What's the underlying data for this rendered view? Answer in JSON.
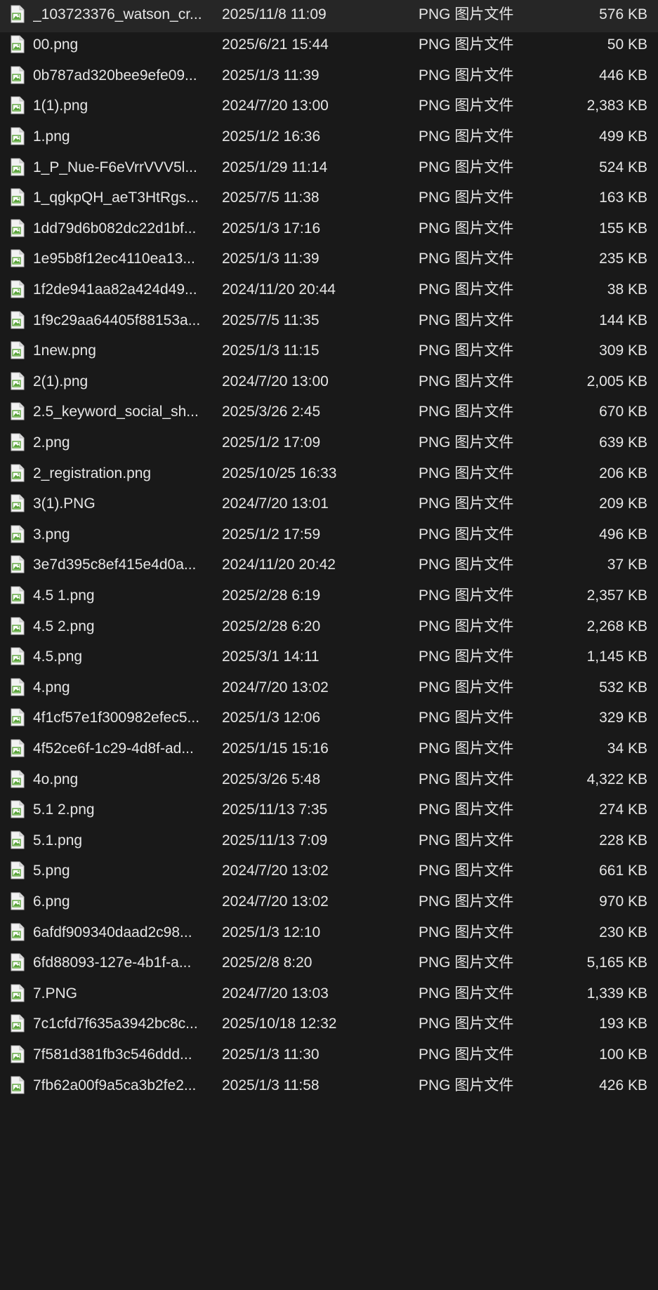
{
  "file_type_label": "PNG 图片文件",
  "icon": "png-image-file-icon",
  "colors": {
    "background": "#191919",
    "text": "#e6e6e6",
    "icon_accent": "#5aa43a"
  },
  "files": [
    {
      "name": "_103723376_watson_cr...",
      "date": "2025/11/8 11:09",
      "type": "PNG 图片文件",
      "size": "576 KB"
    },
    {
      "name": "00.png",
      "date": "2025/6/21 15:44",
      "type": "PNG 图片文件",
      "size": "50 KB"
    },
    {
      "name": "0b787ad320bee9efe09...",
      "date": "2025/1/3 11:39",
      "type": "PNG 图片文件",
      "size": "446 KB"
    },
    {
      "name": "1(1).png",
      "date": "2024/7/20 13:00",
      "type": "PNG 图片文件",
      "size": "2,383 KB"
    },
    {
      "name": "1.png",
      "date": "2025/1/2 16:36",
      "type": "PNG 图片文件",
      "size": "499 KB"
    },
    {
      "name": "1_P_Nue-F6eVrrVVV5l...",
      "date": "2025/1/29 11:14",
      "type": "PNG 图片文件",
      "size": "524 KB"
    },
    {
      "name": "1_qgkpQH_aeT3HtRgs...",
      "date": "2025/7/5 11:38",
      "type": "PNG 图片文件",
      "size": "163 KB"
    },
    {
      "name": "1dd79d6b082dc22d1bf...",
      "date": "2025/1/3 17:16",
      "type": "PNG 图片文件",
      "size": "155 KB"
    },
    {
      "name": "1e95b8f12ec4110ea13...",
      "date": "2025/1/3 11:39",
      "type": "PNG 图片文件",
      "size": "235 KB"
    },
    {
      "name": "1f2de941aa82a424d49...",
      "date": "2024/11/20 20:44",
      "type": "PNG 图片文件",
      "size": "38 KB"
    },
    {
      "name": "1f9c29aa64405f88153a...",
      "date": "2025/7/5 11:35",
      "type": "PNG 图片文件",
      "size": "144 KB"
    },
    {
      "name": "1new.png",
      "date": "2025/1/3 11:15",
      "type": "PNG 图片文件",
      "size": "309 KB"
    },
    {
      "name": "2(1).png",
      "date": "2024/7/20 13:00",
      "type": "PNG 图片文件",
      "size": "2,005 KB"
    },
    {
      "name": "2.5_keyword_social_sh...",
      "date": "2025/3/26 2:45",
      "type": "PNG 图片文件",
      "size": "670 KB"
    },
    {
      "name": "2.png",
      "date": "2025/1/2 17:09",
      "type": "PNG 图片文件",
      "size": "639 KB"
    },
    {
      "name": "2_registration.png",
      "date": "2025/10/25 16:33",
      "type": "PNG 图片文件",
      "size": "206 KB"
    },
    {
      "name": "3(1).PNG",
      "date": "2024/7/20 13:01",
      "type": "PNG 图片文件",
      "size": "209 KB"
    },
    {
      "name": "3.png",
      "date": "2025/1/2 17:59",
      "type": "PNG 图片文件",
      "size": "496 KB"
    },
    {
      "name": "3e7d395c8ef415e4d0a...",
      "date": "2024/11/20 20:42",
      "type": "PNG 图片文件",
      "size": "37 KB"
    },
    {
      "name": "4.5 1.png",
      "date": "2025/2/28 6:19",
      "type": "PNG 图片文件",
      "size": "2,357 KB"
    },
    {
      "name": "4.5 2.png",
      "date": "2025/2/28 6:20",
      "type": "PNG 图片文件",
      "size": "2,268 KB"
    },
    {
      "name": "4.5.png",
      "date": "2025/3/1 14:11",
      "type": "PNG 图片文件",
      "size": "1,145 KB"
    },
    {
      "name": "4.png",
      "date": "2024/7/20 13:02",
      "type": "PNG 图片文件",
      "size": "532 KB"
    },
    {
      "name": "4f1cf57e1f300982efec5...",
      "date": "2025/1/3 12:06",
      "type": "PNG 图片文件",
      "size": "329 KB"
    },
    {
      "name": "4f52ce6f-1c29-4d8f-ad...",
      "date": "2025/1/15 15:16",
      "type": "PNG 图片文件",
      "size": "34 KB"
    },
    {
      "name": "4o.png",
      "date": "2025/3/26 5:48",
      "type": "PNG 图片文件",
      "size": "4,322 KB"
    },
    {
      "name": "5.1 2.png",
      "date": "2025/11/13 7:35",
      "type": "PNG 图片文件",
      "size": "274 KB"
    },
    {
      "name": "5.1.png",
      "date": "2025/11/13 7:09",
      "type": "PNG 图片文件",
      "size": "228 KB"
    },
    {
      "name": "5.png",
      "date": "2024/7/20 13:02",
      "type": "PNG 图片文件",
      "size": "661 KB"
    },
    {
      "name": "6.png",
      "date": "2024/7/20 13:02",
      "type": "PNG 图片文件",
      "size": "970 KB"
    },
    {
      "name": "6afdf909340daad2c98...",
      "date": "2025/1/3 12:10",
      "type": "PNG 图片文件",
      "size": "230 KB"
    },
    {
      "name": "6fd88093-127e-4b1f-a...",
      "date": "2025/2/8 8:20",
      "type": "PNG 图片文件",
      "size": "5,165 KB"
    },
    {
      "name": "7.PNG",
      "date": "2024/7/20 13:03",
      "type": "PNG 图片文件",
      "size": "1,339 KB"
    },
    {
      "name": "7c1cfd7f635a3942bc8c...",
      "date": "2025/10/18 12:32",
      "type": "PNG 图片文件",
      "size": "193 KB"
    },
    {
      "name": "7f581d381fb3c546ddd...",
      "date": "2025/1/3 11:30",
      "type": "PNG 图片文件",
      "size": "100 KB"
    },
    {
      "name": "7fb62a00f9a5ca3b2fe2...",
      "date": "2025/1/3 11:58",
      "type": "PNG 图片文件",
      "size": "426 KB"
    }
  ]
}
